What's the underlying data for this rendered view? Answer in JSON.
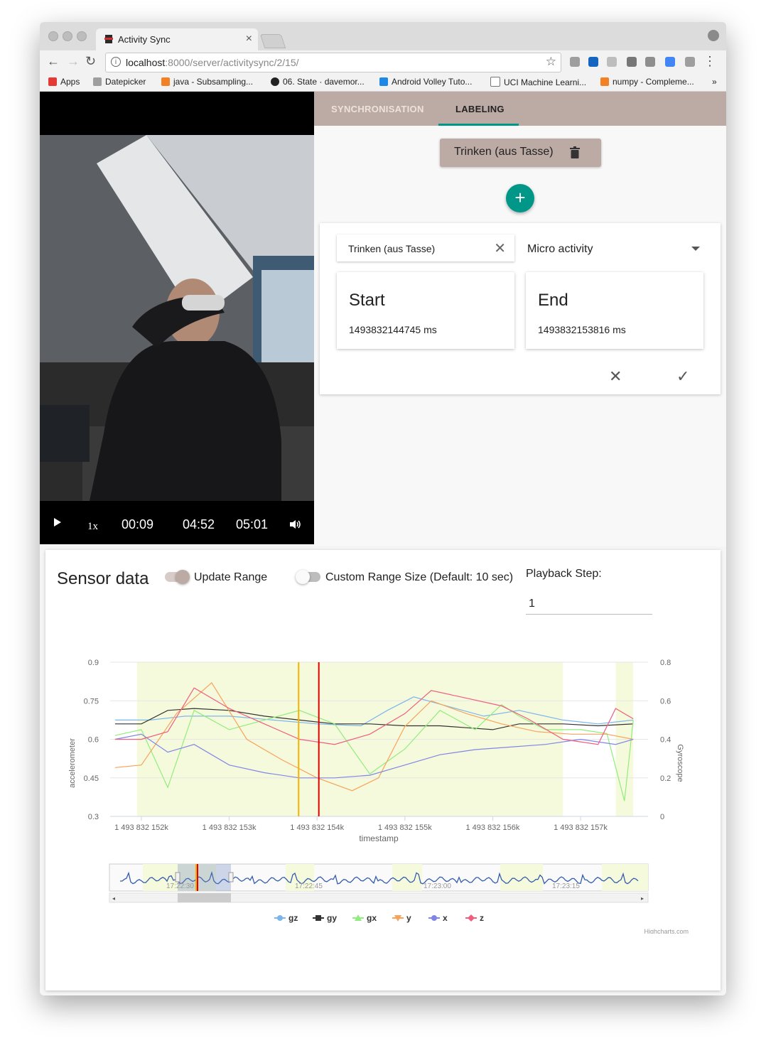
{
  "browser": {
    "tab_title": "Activity Sync",
    "url_host": "localhost",
    "url_rest": ":8000/server/activitysync/2/15/",
    "bookmarks": [
      "Apps",
      "Datepicker",
      "java - Subsampling...",
      "06. State · davemor...",
      "Android Volley Tuto...",
      "UCI Machine Learni...",
      "numpy - Compleme..."
    ],
    "bookmarks_more": "»"
  },
  "video": {
    "rate": "1x",
    "current": "00:09",
    "position": "04:52",
    "duration": "05:01"
  },
  "tabs": {
    "sync": "SYNCHRONISATION",
    "labeling": "LABELING"
  },
  "label_chip": "Trinken (aus Tasse)",
  "add_symbol": "+",
  "editor": {
    "label_value": "Trinken (aus Tasse)",
    "clear_symbol": "✕",
    "category": "Micro activity",
    "start_title": "Start",
    "start_value": "1493832144745 ms",
    "end_title": "End",
    "end_value": "1493832153816 ms",
    "cancel_symbol": "✕",
    "confirm_symbol": "✓"
  },
  "sensor": {
    "title": "Sensor data",
    "update_range_label": "Update Range",
    "update_range_on": true,
    "custom_range_label": "Custom Range Size (Default: 10 sec)",
    "custom_range_on": false,
    "playback_step_label": "Playback Step:",
    "playback_step_value": "1"
  },
  "colors": {
    "teal": "#009688",
    "tan": "#bcaaa4",
    "highlight_band": "#f6fadc",
    "marker_start": "#f2b400",
    "marker_end": "#e00000"
  },
  "chart_data": {
    "type": "line",
    "xlabel": "timestamp",
    "ylabel_left": "accelerometer",
    "ylabel_right": "Gyroscope",
    "x_ticks": [
      "1 493 832 152k",
      "1 493 832 153k",
      "1 493 832 154k",
      "1 493 832 155k",
      "1 493 832 156k",
      "1 493 832 157k"
    ],
    "x_range": [
      1493832151700,
      1493832157600
    ],
    "ylim_left": [
      0.3,
      0.9
    ],
    "ylim_right": [
      0,
      0.8
    ],
    "left_ticks": [
      "0.9",
      "0.75",
      "0.6",
      "0.45",
      "0.3"
    ],
    "right_ticks": [
      "0.8",
      "0.6",
      "0.4",
      "0.2",
      "0"
    ],
    "highlight_bands": [
      [
        1493832151950,
        1493832156800
      ],
      [
        1493832157400,
        1493832157600
      ]
    ],
    "markers": [
      1493832153790,
      1493832154020
    ],
    "legend": [
      "gz",
      "gy",
      "gx",
      "y",
      "x",
      "z"
    ],
    "series": [
      {
        "name": "gz",
        "color": "#7cb5ec",
        "axis": "right",
        "x": [
          151700,
          152100,
          152500,
          153000,
          153500,
          154000,
          154500,
          154800,
          155100,
          155500,
          155900,
          156300,
          156800,
          157200,
          157600
        ],
        "y": [
          0.5,
          0.5,
          0.52,
          0.52,
          0.5,
          0.48,
          0.47,
          0.55,
          0.62,
          0.57,
          0.52,
          0.55,
          0.5,
          0.48,
          0.5
        ]
      },
      {
        "name": "gy",
        "color": "#333333",
        "axis": "right",
        "x": [
          151700,
          152000,
          152300,
          152600,
          153000,
          153400,
          153800,
          154200,
          154600,
          155000,
          155400,
          155700,
          156000,
          156300,
          156800,
          157200,
          157600
        ],
        "y": [
          0.48,
          0.48,
          0.55,
          0.56,
          0.55,
          0.52,
          0.5,
          0.48,
          0.48,
          0.47,
          0.47,
          0.46,
          0.45,
          0.48,
          0.48,
          0.47,
          0.48
        ]
      },
      {
        "name": "gx",
        "color": "#90ed7d",
        "axis": "right",
        "x": [
          151700,
          152000,
          152300,
          152600,
          153000,
          153400,
          153800,
          154200,
          154600,
          155000,
          155400,
          155800,
          156100,
          156300,
          156600,
          157000,
          157300,
          157500,
          157600
        ],
        "y": [
          0.42,
          0.45,
          0.15,
          0.55,
          0.45,
          0.5,
          0.55,
          0.48,
          0.22,
          0.35,
          0.55,
          0.45,
          0.58,
          0.52,
          0.45,
          0.45,
          0.43,
          0.08,
          0.5
        ]
      },
      {
        "name": "y",
        "color": "#f7a35c",
        "axis": "left",
        "x": [
          151700,
          152000,
          152400,
          152800,
          153200,
          153600,
          154000,
          154400,
          154700,
          155000,
          155300,
          155700,
          156100,
          156500,
          156900,
          157300,
          157600
        ],
        "y": [
          0.49,
          0.5,
          0.7,
          0.82,
          0.6,
          0.52,
          0.45,
          0.4,
          0.45,
          0.65,
          0.75,
          0.7,
          0.66,
          0.63,
          0.62,
          0.62,
          0.6
        ]
      },
      {
        "name": "x",
        "color": "#8085e9",
        "axis": "left",
        "x": [
          151700,
          152000,
          152300,
          152600,
          153000,
          153400,
          153800,
          154200,
          154600,
          155000,
          155400,
          155800,
          156200,
          156600,
          157000,
          157400,
          157600
        ],
        "y": [
          0.6,
          0.62,
          0.55,
          0.58,
          0.5,
          0.47,
          0.45,
          0.45,
          0.46,
          0.5,
          0.54,
          0.56,
          0.57,
          0.58,
          0.6,
          0.58,
          0.6
        ]
      },
      {
        "name": "z",
        "color": "#f15c80",
        "axis": "left",
        "x": [
          151700,
          152000,
          152300,
          152600,
          153000,
          153400,
          153800,
          154200,
          154600,
          155000,
          155300,
          155700,
          156100,
          156400,
          156800,
          157200,
          157400,
          157600
        ],
        "y": [
          0.6,
          0.6,
          0.63,
          0.8,
          0.72,
          0.66,
          0.6,
          0.58,
          0.62,
          0.7,
          0.79,
          0.76,
          0.73,
          0.68,
          0.6,
          0.58,
          0.72,
          0.68
        ]
      }
    ],
    "navigator": {
      "time_labels": [
        "17:22:30",
        "17:22:45",
        "17:23:00",
        "17:23:15"
      ],
      "color": "#335cad"
    },
    "credits": "Highcharts.com"
  }
}
